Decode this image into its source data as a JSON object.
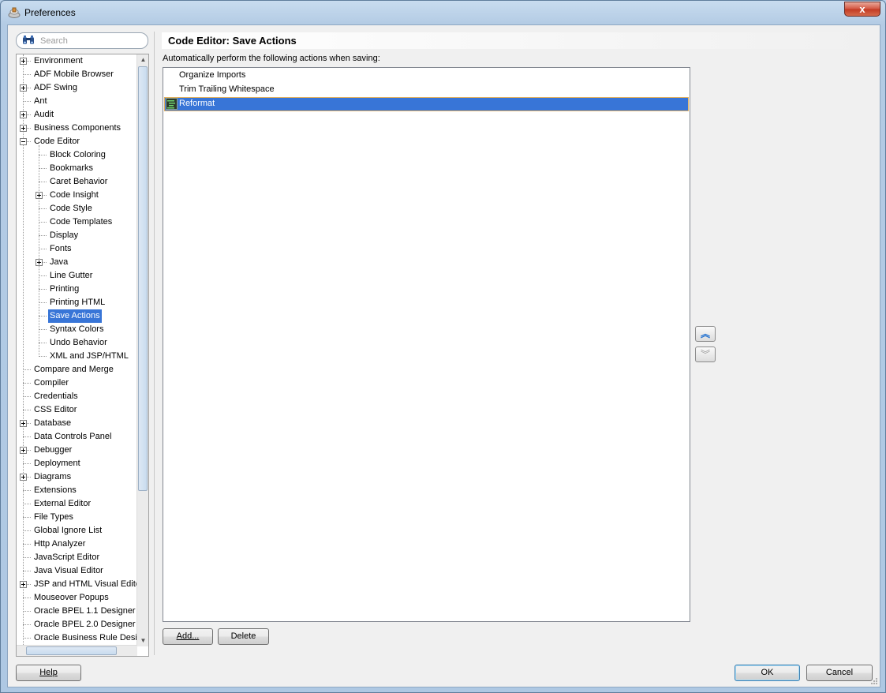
{
  "window": {
    "title": "Preferences",
    "close_glyph": "x"
  },
  "search": {
    "placeholder": "Search",
    "value": ""
  },
  "tree": {
    "items": [
      {
        "label": "Environment",
        "level": 0,
        "expander": "plus"
      },
      {
        "label": "ADF Mobile Browser",
        "level": 0,
        "expander": "none"
      },
      {
        "label": "ADF Swing",
        "level": 0,
        "expander": "plus"
      },
      {
        "label": "Ant",
        "level": 0,
        "expander": "none"
      },
      {
        "label": "Audit",
        "level": 0,
        "expander": "plus"
      },
      {
        "label": "Business Components",
        "level": 0,
        "expander": "plus"
      },
      {
        "label": "Code Editor",
        "level": 0,
        "expander": "minus"
      },
      {
        "label": "Block Coloring",
        "level": 1,
        "expander": "none"
      },
      {
        "label": "Bookmarks",
        "level": 1,
        "expander": "none"
      },
      {
        "label": "Caret Behavior",
        "level": 1,
        "expander": "none"
      },
      {
        "label": "Code Insight",
        "level": 1,
        "expander": "plus"
      },
      {
        "label": "Code Style",
        "level": 1,
        "expander": "none"
      },
      {
        "label": "Code Templates",
        "level": 1,
        "expander": "none"
      },
      {
        "label": "Display",
        "level": 1,
        "expander": "none"
      },
      {
        "label": "Fonts",
        "level": 1,
        "expander": "none"
      },
      {
        "label": "Java",
        "level": 1,
        "expander": "plus"
      },
      {
        "label": "Line Gutter",
        "level": 1,
        "expander": "none"
      },
      {
        "label": "Printing",
        "level": 1,
        "expander": "none"
      },
      {
        "label": "Printing HTML",
        "level": 1,
        "expander": "none"
      },
      {
        "label": "Save Actions",
        "level": 1,
        "expander": "none",
        "selected": true
      },
      {
        "label": "Syntax Colors",
        "level": 1,
        "expander": "none"
      },
      {
        "label": "Undo Behavior",
        "level": 1,
        "expander": "none"
      },
      {
        "label": "XML and JSP/HTML",
        "level": 1,
        "expander": "none"
      },
      {
        "label": "Compare and Merge",
        "level": 0,
        "expander": "none"
      },
      {
        "label": "Compiler",
        "level": 0,
        "expander": "none"
      },
      {
        "label": "Credentials",
        "level": 0,
        "expander": "none"
      },
      {
        "label": "CSS Editor",
        "level": 0,
        "expander": "none"
      },
      {
        "label": "Database",
        "level": 0,
        "expander": "plus"
      },
      {
        "label": "Data Controls Panel",
        "level": 0,
        "expander": "none"
      },
      {
        "label": "Debugger",
        "level": 0,
        "expander": "plus"
      },
      {
        "label": "Deployment",
        "level": 0,
        "expander": "none"
      },
      {
        "label": "Diagrams",
        "level": 0,
        "expander": "plus"
      },
      {
        "label": "Extensions",
        "level": 0,
        "expander": "none"
      },
      {
        "label": "External Editor",
        "level": 0,
        "expander": "none"
      },
      {
        "label": "File Types",
        "level": 0,
        "expander": "none"
      },
      {
        "label": "Global Ignore List",
        "level": 0,
        "expander": "none"
      },
      {
        "label": "Http Analyzer",
        "level": 0,
        "expander": "none"
      },
      {
        "label": "JavaScript Editor",
        "level": 0,
        "expander": "none"
      },
      {
        "label": "Java Visual Editor",
        "level": 0,
        "expander": "none"
      },
      {
        "label": "JSP and HTML Visual Editor",
        "level": 0,
        "expander": "plus"
      },
      {
        "label": "Mouseover Popups",
        "level": 0,
        "expander": "none"
      },
      {
        "label": "Oracle BPEL 1.1 Designer",
        "level": 0,
        "expander": "none"
      },
      {
        "label": "Oracle BPEL 2.0 Designer",
        "level": 0,
        "expander": "none"
      },
      {
        "label": "Oracle Business Rule Designer",
        "level": 0,
        "expander": "none"
      }
    ]
  },
  "page": {
    "title": "Code Editor: Save Actions",
    "description": "Automatically perform the following actions when saving:"
  },
  "actions": [
    {
      "label": "Organize Imports",
      "selected": false
    },
    {
      "label": "Trim Trailing Whitespace",
      "selected": false
    },
    {
      "label": "Reformat",
      "selected": true
    }
  ],
  "buttons": {
    "add": "Add...",
    "delete": "Delete",
    "move_up_glyph": "︽",
    "move_down_glyph": "︾",
    "help": "Help",
    "ok": "OK",
    "cancel": "Cancel"
  },
  "colors": {
    "selection": "#3875d7",
    "accent_up_arrow": "#1e6fd0"
  }
}
